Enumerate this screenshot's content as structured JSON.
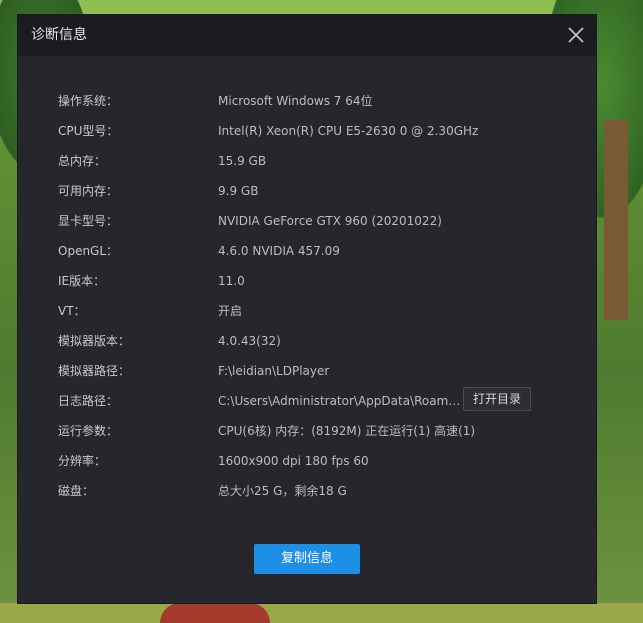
{
  "dialog": {
    "title": "诊断信息",
    "rows": [
      {
        "label": "操作系统：",
        "value": "Microsoft Windows 7 64位"
      },
      {
        "label": "CPU型号：",
        "value": "Intel(R) Xeon(R) CPU E5-2630 0 @ 2.30GHz"
      },
      {
        "label": "总内存：",
        "value": "15.9 GB"
      },
      {
        "label": "可用内存：",
        "value": "9.9 GB"
      },
      {
        "label": "显卡型号：",
        "value": "NVIDIA GeForce GTX 960 (20201022)"
      },
      {
        "label": "OpenGL：",
        "value": "4.6.0 NVIDIA 457.09"
      },
      {
        "label": "IE版本：",
        "value": "11.0"
      },
      {
        "label": "VT：",
        "value": "开启"
      },
      {
        "label": "模拟器版本：",
        "value": "4.0.43(32)"
      },
      {
        "label": "模拟器路径：",
        "value": "F:\\leidian\\LDPlayer"
      },
      {
        "label": "日志路径：",
        "value": "C:\\Users\\Administrator\\AppData\\Roami..."
      },
      {
        "label": "运行参数：",
        "value": "CPU(6核) 内存：(8192M) 正在运行(1) 高速(1)"
      },
      {
        "label": "分辨率：",
        "value": "1600x900 dpi 180 fps 60"
      },
      {
        "label": "磁盘：",
        "value": "总大小25 G，剩余18 G"
      }
    ],
    "open_dir_label": "打开目录",
    "copy_label": "复制信息"
  },
  "colors": {
    "dialog_bg": "#26272d",
    "titlebar_bg": "#1b1c21",
    "accent": "#1e8fe6"
  }
}
